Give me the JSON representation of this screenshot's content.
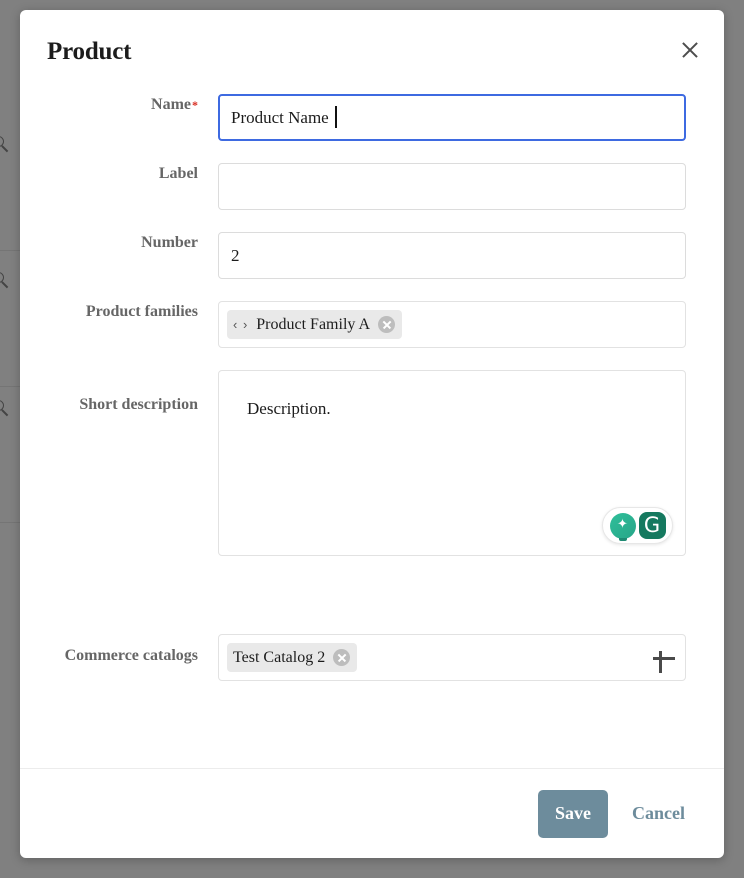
{
  "modal": {
    "title": "Product",
    "close_icon": "close-icon"
  },
  "form": {
    "fields": [
      {
        "label": "Name",
        "required_marker": "*",
        "value": "Product Name",
        "placeholder": "",
        "type": "text",
        "focused": true
      },
      {
        "label": "Label",
        "value": "",
        "placeholder": "",
        "type": "text",
        "focused": false
      },
      {
        "label": "Number",
        "value": "2",
        "placeholder": "",
        "type": "text",
        "focused": false
      },
      {
        "label": "Product families",
        "type": "chips",
        "add_icon": "plus-icon",
        "chips": [
          {
            "handle_icon": "drag-handle-icon",
            "handle_glyph": "‹ ›",
            "label": "Product Family A",
            "remove_icon": "remove-chip-icon"
          }
        ]
      },
      {
        "label": "Short description",
        "type": "textarea",
        "value": "Description.",
        "assistant": {
          "bulb_icon": "ai-suggestion-icon",
          "bulb_glyph": "✦",
          "grammarly_icon": "grammarly-icon",
          "grammarly_glyph": "G"
        }
      },
      {
        "label": "Commerce catalogs",
        "type": "chips",
        "add_icon": "plus-icon",
        "chips": [
          {
            "label": "Test Catalog 2",
            "remove_icon": "remove-chip-icon"
          }
        ]
      }
    ]
  },
  "footer": {
    "save_label": "Save",
    "cancel_label": "Cancel"
  },
  "background": {
    "search_icon": "search-icon"
  },
  "colors": {
    "accent": "#6d8c9c",
    "focus_border": "#3e6ae1",
    "required": "#d93025",
    "overlay": "#808080",
    "chip_bg": "#e9e9e9",
    "grammarly_green": "#15795f"
  }
}
